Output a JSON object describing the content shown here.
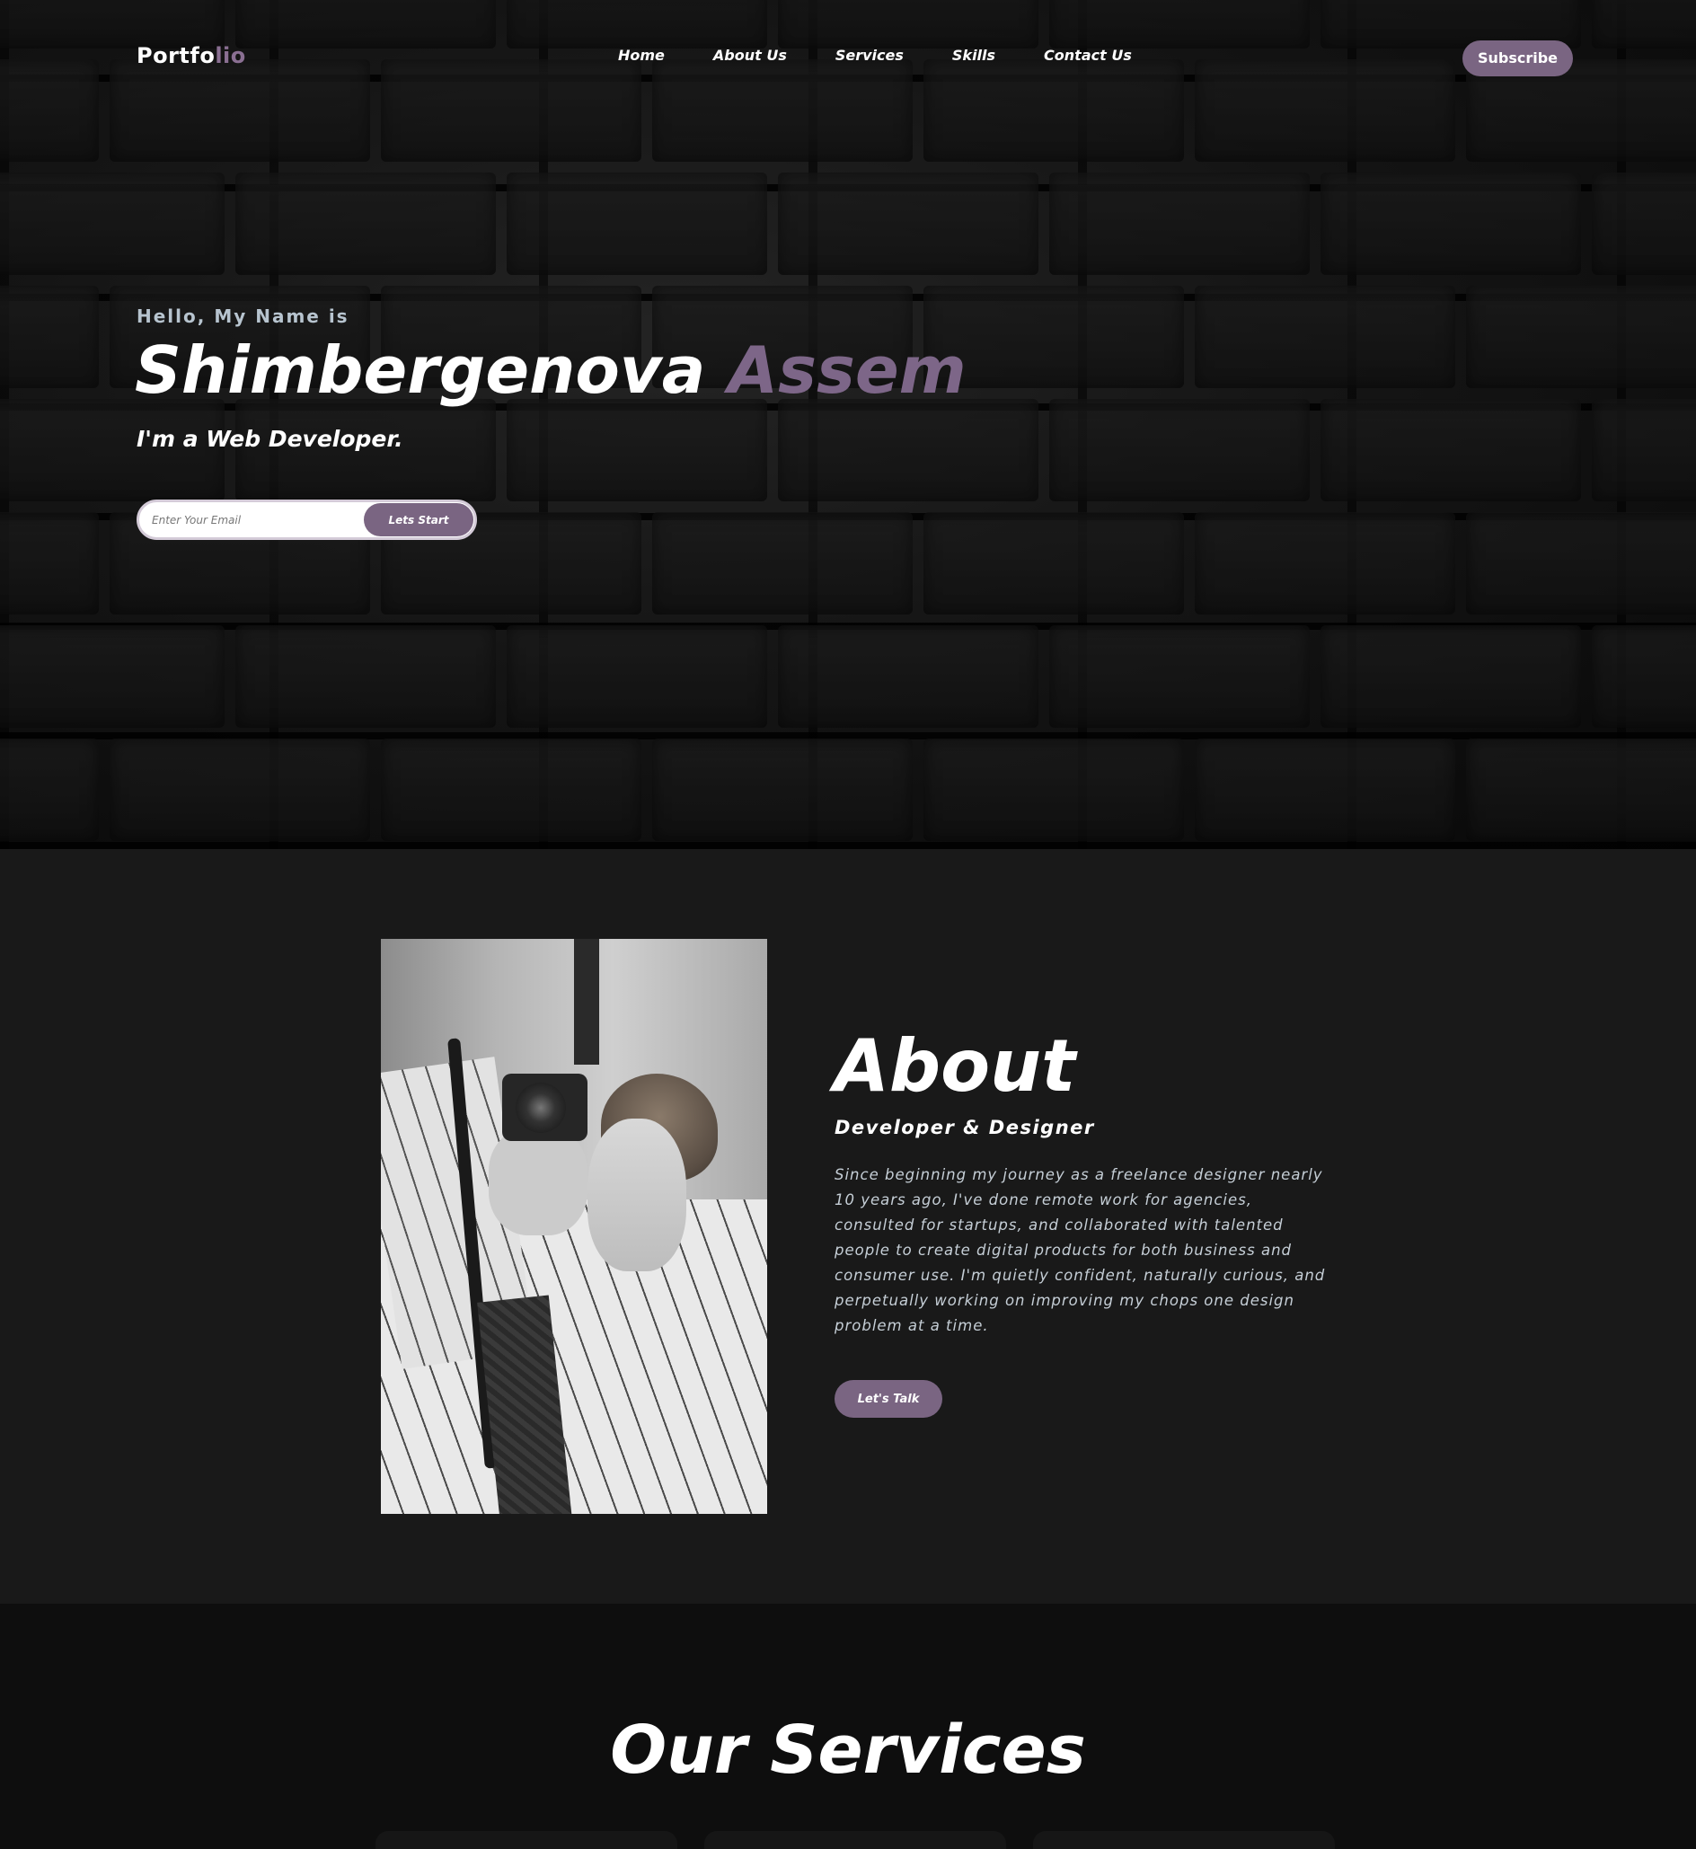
{
  "nav": {
    "logo_main": "Portfo",
    "logo_accent": "lio",
    "links": [
      "Home",
      "About Us",
      "Services",
      "Skills",
      "Contact Us"
    ],
    "subscribe_label": "Subscribe"
  },
  "hero": {
    "greeting": "Hello, My Name is",
    "name_first": "Shimbergenova",
    "name_accent": "Assem",
    "role": "I'm a Web Developer.",
    "email_placeholder": "Enter Your Email",
    "start_label": "Lets Start"
  },
  "about": {
    "title": "About",
    "subtitle": "Developer & Designer",
    "text": "Since beginning my journey as a freelance designer nearly 10 years ago, I've done remote work for agencies, consulted for startups, and collaborated with talented people to create digital products for both business and consumer use. I'm quietly confident, naturally curious, and perpetually working on improving my chops one design problem at a time.",
    "cta_label": "Let's Talk"
  },
  "services": {
    "title": "Our Services"
  },
  "colors": {
    "accent": "#7a6582",
    "hero_bg": "#0b0b0b",
    "about_bg": "#191919",
    "services_bg": "#0e0e0e"
  }
}
